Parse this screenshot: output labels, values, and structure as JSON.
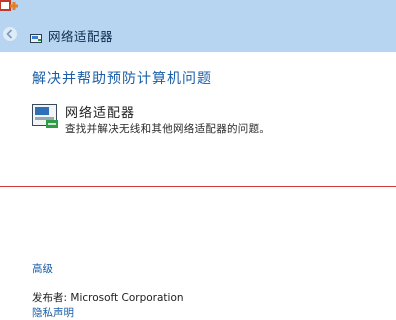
{
  "breadcrumb": {
    "icon": "network-adapter-icon",
    "title": "网络适配器"
  },
  "main": {
    "heading": "解决并帮助预防计算机问题",
    "troubleshooter": {
      "icon": "network-adapter-icon",
      "title": "网络适配器",
      "description": "查找并解决无线和其他网络适配器的问题。"
    },
    "advanced_link": "高级",
    "publisher_label": "发布者:",
    "publisher_value": "Microsoft Corporation",
    "privacy_link": "隐私声明"
  },
  "colors": {
    "titlebar": "#b7d5f0",
    "link": "#1a5ea8",
    "divider": "#cf3a3a"
  }
}
